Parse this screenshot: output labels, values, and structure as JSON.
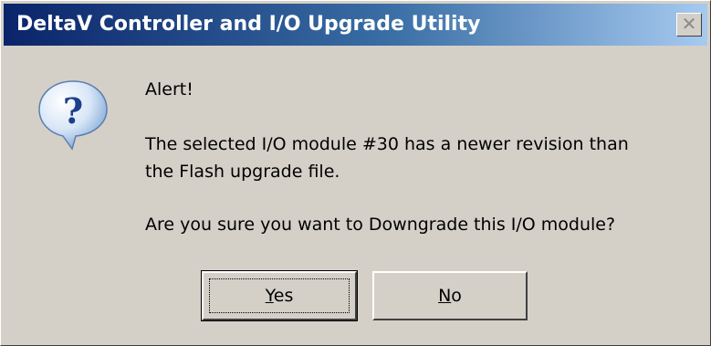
{
  "window": {
    "title": "DeltaV Controller and I/O Upgrade Utility",
    "close_glyph": "✕"
  },
  "icon": {
    "name": "question-icon",
    "glyph": "?"
  },
  "message": {
    "heading": "Alert!",
    "line1": "The selected I/O module #30 has a newer revision than",
    "line2": "the Flash upgrade file.",
    "question": "Are you sure you want to Downgrade this I/O module?"
  },
  "buttons": {
    "yes_mnemonic": "Y",
    "yes_rest": "es",
    "no_mnemonic": "N",
    "no_rest": "o"
  },
  "colors": {
    "dialog_bg": "#d4d0c8",
    "title_start": "#0a246a",
    "title_end": "#a6caf0"
  }
}
